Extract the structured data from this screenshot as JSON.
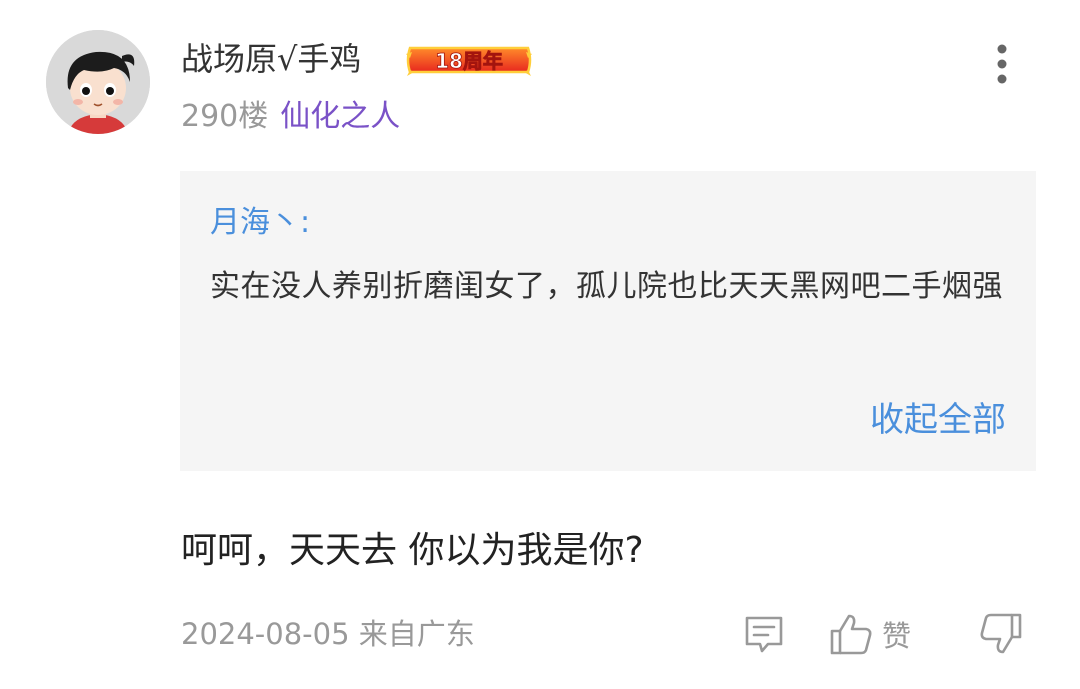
{
  "post": {
    "username": "战场原√手鸡",
    "badge": "18周年",
    "floor": "290楼",
    "level": "仙化之人",
    "quote": {
      "author": "月海丶:",
      "text": "实在没人养别折磨闺女了，孤儿院也比天天黑网吧二手烟强",
      "collapse_label": "收起全部"
    },
    "reply_text": "呵呵，天天去 你以为我是你?",
    "date": "2024-08-05",
    "location": "来自广东",
    "like_label": "赞"
  },
  "colors": {
    "level": "#7a52c7",
    "link": "#4a8fdc",
    "muted": "#999999",
    "quote_bg": "#f5f5f5"
  },
  "icons": {
    "more": "more-vertical-icon",
    "comment": "comment-icon",
    "like": "thumbs-up-icon",
    "dislike": "thumbs-down-icon"
  }
}
